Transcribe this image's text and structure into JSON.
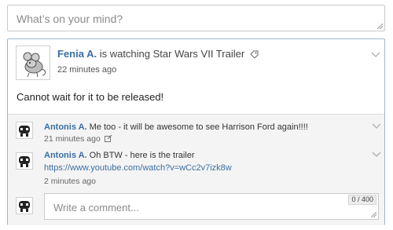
{
  "composer": {
    "placeholder": "What’s on your mind?"
  },
  "post": {
    "author": "Fenia A.",
    "action": " is watching Star Wars VII Trailer",
    "time": "22 minutes ago",
    "body": "Cannot wait for it to be released!"
  },
  "comments": [
    {
      "author": "Antonis A.",
      "text": " Me too - it will be awesome to see Harrison Ford again!!!!",
      "time": "21 minutes ago"
    },
    {
      "author": "Antonis A.",
      "text": " Oh BTW - here is the trailer",
      "link": "https://www.youtube.com/watch?v=wCc2v7izk8w",
      "time": "2 minutes ago"
    }
  ],
  "reply": {
    "placeholder": "Write a comment...",
    "counter": "0 / 400"
  },
  "colors": {
    "link": "#3b6ea5",
    "card_border": "#9fb6cf",
    "comment_bg": "#f4f4f4"
  }
}
